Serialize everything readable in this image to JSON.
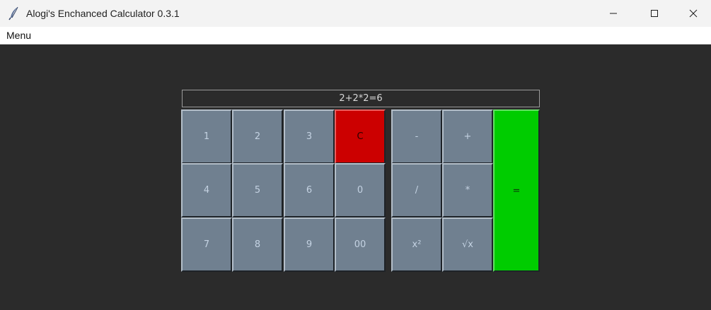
{
  "window": {
    "title": "Alogi's Enchanced Calculator 0.3.1"
  },
  "menu": {
    "items": [
      "Menu"
    ]
  },
  "display": {
    "value": "2+2*2=6"
  },
  "keypad": {
    "digits": [
      "1",
      "2",
      "3",
      "C",
      "4",
      "5",
      "6",
      "0",
      "7",
      "8",
      "9",
      "00"
    ],
    "operators": [
      "-",
      "+",
      "/",
      "*",
      "x²",
      "√x"
    ],
    "equals": "="
  },
  "colors": {
    "background": "#2b2b2b",
    "key": "#708090",
    "clear_key": "#cc0000",
    "equals_key": "#00cc00"
  },
  "icons": {
    "app": "feather-icon",
    "minimize": "minimize-icon",
    "maximize": "maximize-icon",
    "close": "close-icon"
  }
}
